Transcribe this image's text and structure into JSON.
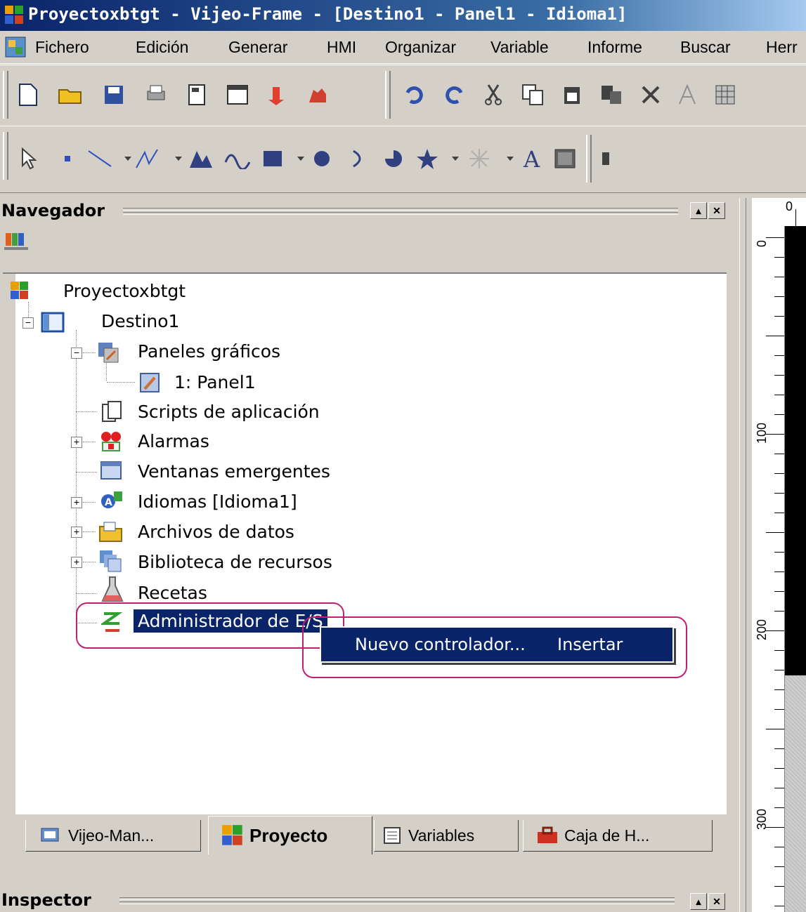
{
  "window": {
    "title": "Proyectoxbtgt - Vijeo-Frame - [Destino1 - Panel1 - Idioma1]"
  },
  "menubar": {
    "items": [
      "Fichero",
      "Edición",
      "Generar",
      "HMI",
      "Organizar",
      "Variable",
      "Informe",
      "Buscar",
      "Herr"
    ]
  },
  "toolbar1": {
    "icons": [
      "new-file-icon",
      "open-folder-icon",
      "save-icon",
      "print-icon",
      "page-icon",
      "page-setup-icon",
      "import-icon",
      "export-icon",
      "undo-icon",
      "redo-icon",
      "cut-icon",
      "copy-icon",
      "paste-icon",
      "paste-special-icon",
      "delete-icon",
      "text-tool-icon",
      "grid-icon"
    ]
  },
  "toolbar2": {
    "icons": [
      "pointer-icon",
      "dot-icon",
      "line-icon",
      "polyline-icon",
      "polygon-icon",
      "curve-icon",
      "rectangle-icon",
      "circle-icon",
      "arc-icon",
      "pie-icon",
      "star-icon",
      "burst-icon",
      "text-icon",
      "image-icon",
      "align-icon"
    ]
  },
  "navigator": {
    "title": "Navegador",
    "tree": [
      {
        "label": "Proyectoxbtgt",
        "icon": "project-icon",
        "level": 0
      },
      {
        "label": "Destino1",
        "icon": "target-icon",
        "level": 1
      },
      {
        "label": "Paneles gráficos",
        "icon": "panels-icon",
        "level": 2
      },
      {
        "label": "1: Panel1",
        "icon": "panel-icon",
        "level": 3
      },
      {
        "label": "Scripts de aplicación",
        "icon": "scripts-icon",
        "level": 2
      },
      {
        "label": "Alarmas",
        "icon": "alarms-icon",
        "level": 2
      },
      {
        "label": "Ventanas emergentes",
        "icon": "popup-windows-icon",
        "level": 2
      },
      {
        "label": "Idiomas [Idioma1]",
        "icon": "languages-icon",
        "level": 2
      },
      {
        "label": "Archivos de datos",
        "icon": "data-files-icon",
        "level": 2
      },
      {
        "label": "Biblioteca de recursos",
        "icon": "resource-library-icon",
        "level": 2
      },
      {
        "label": "Recetas",
        "icon": "recipes-icon",
        "level": 2
      },
      {
        "label": "Administrador de E/S",
        "icon": "io-manager-icon",
        "level": 2
      }
    ]
  },
  "context_menu": {
    "item_label": "Nuevo controlador...",
    "item_shortcut": "Insertar"
  },
  "tabs": [
    {
      "label": "Vijeo-Man...",
      "icon": "manager-icon"
    },
    {
      "label": "Proyecto",
      "icon": "project-icon",
      "active": true
    },
    {
      "label": "Variables",
      "icon": "variables-icon"
    },
    {
      "label": "Caja de H...",
      "icon": "toolbox-icon"
    }
  ],
  "inspector": {
    "title": "Inspector"
  },
  "ruler": {
    "top_label": "0",
    "left_labels": [
      "0",
      "100",
      "200",
      "300"
    ]
  },
  "colors": {
    "selection": "#0a246a",
    "highlight_annotation": "#c02070",
    "titlebar": "#0a246a"
  }
}
